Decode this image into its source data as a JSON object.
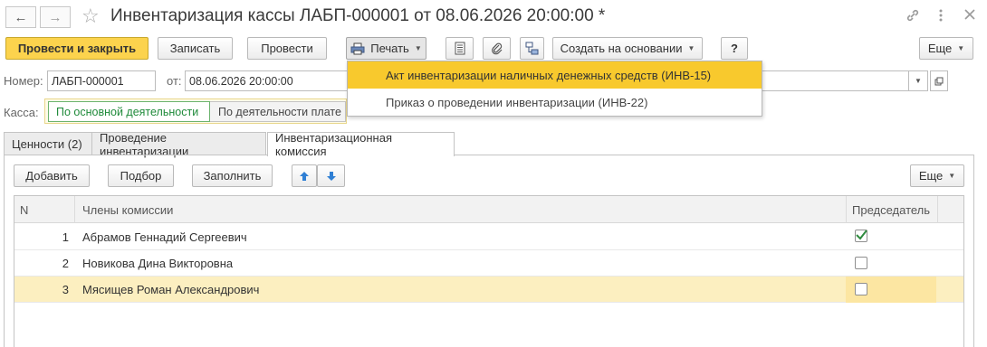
{
  "window": {
    "title": "Инвентаризация кассы ЛАБП-000001 от 08.06.2026 20:00:00 *"
  },
  "toolbar": {
    "post_close": "Провести и закрыть",
    "write": "Записать",
    "post": "Провести",
    "print": "Печать",
    "create_based": "Создать на основании",
    "help": "?",
    "more": "Еще"
  },
  "print_menu": {
    "items": [
      "Акт инвентаризации наличных денежных средств (ИНВ-15)",
      "Приказ о проведении инвентаризации (ИНВ-22)"
    ],
    "highlighted_index": 0
  },
  "header": {
    "number_label": "Номер:",
    "number_value": "ЛАБП-000001",
    "date_label": "от:",
    "date_value": "08.06.2026 20:00:00",
    "cash_label": "Касса:",
    "cash_options": [
      "По основной деятельности",
      "По деятельности плате"
    ],
    "cash_selected": 0
  },
  "tabs": [
    {
      "label": "Ценности (2)",
      "active": false
    },
    {
      "label": "Проведение инвентаризации",
      "active": false
    },
    {
      "label": "Инвентаризационная комиссия",
      "active": true
    }
  ],
  "commission": {
    "add": "Добавить",
    "pick": "Подбор",
    "fill": "Заполнить",
    "more": "Еще",
    "columns": [
      "N",
      "Члены комиссии",
      "Председатель"
    ],
    "rows": [
      {
        "n": "1",
        "name": "Абрамов Геннадий Сергеевич",
        "chairman": true
      },
      {
        "n": "2",
        "name": "Новикова Дина Викторовна",
        "chairman": false
      },
      {
        "n": "3",
        "name": "Мясищев Роман Александрович",
        "chairman": false
      }
    ],
    "selected_row": 2
  },
  "colors": {
    "primary": "#fcd34d",
    "menu_highlight": "#f8c92d",
    "selected_row": "#fcefc0",
    "radio_active": "#1f8a3a",
    "arrow_blue": "#2f7fd4",
    "check_green": "#2e8b3e"
  },
  "icons": [
    "back-arrow-icon",
    "forward-arrow-icon",
    "star-icon",
    "link-icon",
    "more-vertical-icon",
    "close-icon",
    "printer-icon",
    "report-icon",
    "paperclip-icon",
    "structure-icon",
    "arrow-up-icon",
    "arrow-down-icon",
    "checkmark-icon",
    "open-icon"
  ]
}
